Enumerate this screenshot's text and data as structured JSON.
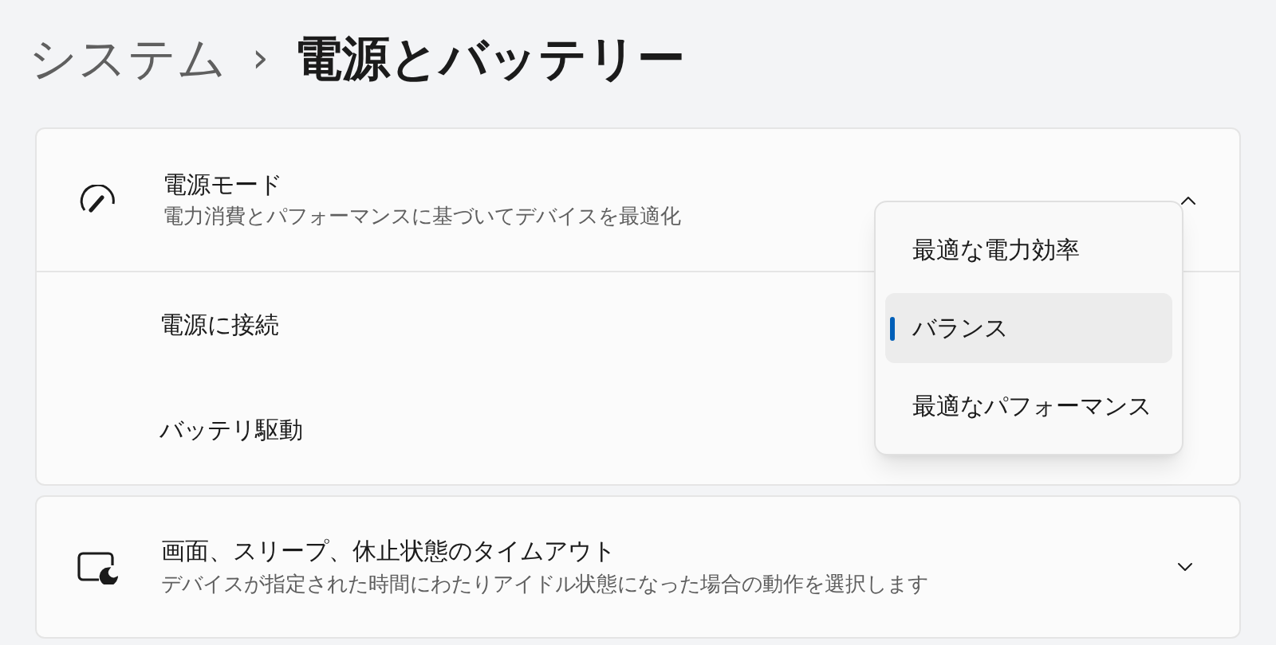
{
  "breadcrumb": {
    "parent": "システム",
    "separator": "›",
    "current": "電源とバッテリー"
  },
  "power_mode": {
    "title": "電源モード",
    "description": "電力消費とパフォーマンスに基づいてデバイスを最適化",
    "expanded": true,
    "sub_rows": [
      {
        "label": "電源に接続"
      },
      {
        "label": "バッテリ駆動"
      }
    ],
    "menu": [
      {
        "label": "最適な電力効率",
        "selected": false
      },
      {
        "label": "バランス",
        "selected": true
      },
      {
        "label": "最適なパフォーマンス",
        "selected": false
      }
    ]
  },
  "screen_sleep": {
    "title": "画面、スリープ、休止状態のタイムアウト",
    "description": "デバイスが指定された時間にわたりアイドル状態になった場合の動作を選択します",
    "expanded": false
  }
}
